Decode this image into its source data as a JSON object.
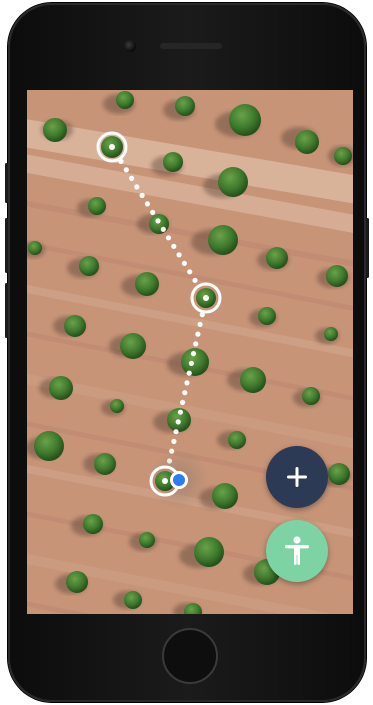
{
  "app": {
    "map_view": "aerial-orchard-map"
  },
  "colors": {
    "soil": "#c8967a",
    "tree": "#3f7a2e",
    "route": "#ffffff",
    "location_dot": "#2f7bf6",
    "fab_add_bg": "#2c3a55",
    "fab_access_bg": "#7dd3a4"
  },
  "icons": {
    "add": "plus-icon",
    "accessibility": "accessibility-icon",
    "location": "current-location-icon",
    "waypoint": "waypoint-marker-icon"
  },
  "route": {
    "waypoint_count": 3
  }
}
